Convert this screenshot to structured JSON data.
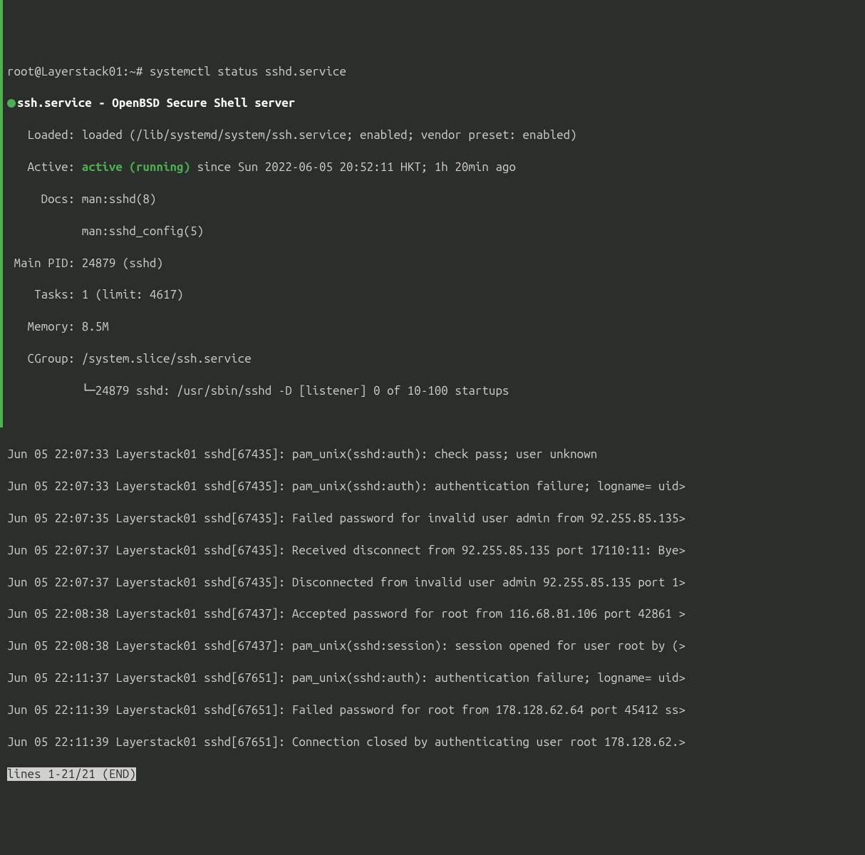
{
  "prompt": "root@Layerstack01:~# ",
  "command": "systemctl status sshd.service",
  "unit_line": "ssh.service - OpenBSD Secure Shell server",
  "loaded_label": "   Loaded: ",
  "loaded_value": "loaded (/lib/systemd/system/ssh.service; enabled; vendor preset: enabled)",
  "active_label": "   Active: ",
  "active_status": "active (running)",
  "active_rest": " since Sun 2022-06-05 20:52:11 HKT; 1h 20min ago",
  "docs_label": "     Docs: ",
  "docs_value1": "man:sshd(8)",
  "docs_value2": "           man:sshd_config(5)",
  "mainpid_label": " Main PID: ",
  "mainpid_value": "24879 (sshd)",
  "tasks_label": "    Tasks: ",
  "tasks_value": "1 (limit: 4617)",
  "memory_label": "   Memory: ",
  "memory_value": "8.5M",
  "cgroup_label": "   CGroup: ",
  "cgroup_value": "/system.slice/ssh.service",
  "cgroup_tree": "           └─24879 sshd: /usr/sbin/sshd -D [listener] 0 of 10-100 startups",
  "logs": [
    "Jun 05 22:07:33 Layerstack01 sshd[67435]: pam_unix(sshd:auth): check pass; user unknown",
    "Jun 05 22:07:33 Layerstack01 sshd[67435]: pam_unix(sshd:auth): authentication failure; logname= uid>",
    "Jun 05 22:07:35 Layerstack01 sshd[67435]: Failed password for invalid user admin from 92.255.85.135>",
    "Jun 05 22:07:37 Layerstack01 sshd[67435]: Received disconnect from 92.255.85.135 port 17110:11: Bye>",
    "Jun 05 22:07:37 Layerstack01 sshd[67435]: Disconnected from invalid user admin 92.255.85.135 port 1>",
    "Jun 05 22:08:38 Layerstack01 sshd[67437]: Accepted password for root from 116.68.81.106 port 42861 >",
    "Jun 05 22:08:38 Layerstack01 sshd[67437]: pam_unix(sshd:session): session opened for user root by (>",
    "Jun 05 22:11:37 Layerstack01 sshd[67651]: pam_unix(sshd:auth): authentication failure; logname= uid>",
    "Jun 05 22:11:39 Layerstack01 sshd[67651]: Failed password for root from 178.128.62.64 port 45412 ss>",
    "Jun 05 22:11:39 Layerstack01 sshd[67651]: Connection closed by authenticating user root 178.128.62.>"
  ],
  "pager_status": "lines 1-21/21 (END)"
}
